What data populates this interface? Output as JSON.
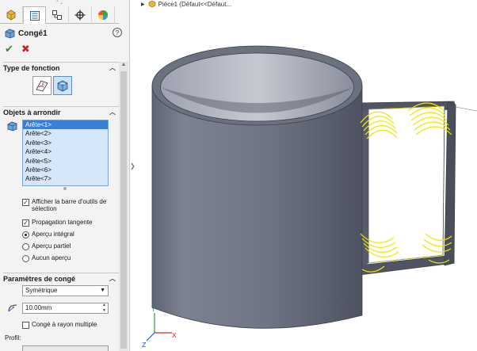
{
  "window": {
    "tree_title": "Pièce1  (Défaut<<Défaut..."
  },
  "tabs": [
    {
      "icon": "feature-manager-icon"
    },
    {
      "icon": "property-manager-icon"
    },
    {
      "icon": "configuration-manager-icon"
    },
    {
      "icon": "dimxpert-icon"
    },
    {
      "icon": "display-manager-icon"
    }
  ],
  "property_manager": {
    "title": "Congé1",
    "help": "?",
    "sections": {
      "fillet_type": "Type de fonction",
      "items_to_fillet": "Objets à arrondir",
      "fillet_params": "Paramètres de congé",
      "profile": "Profil:"
    },
    "edges": [
      "Arête<1>",
      "Arête<2>",
      "Arête<3>",
      "Arête<4>",
      "Arête<5>",
      "Arête<6>",
      "Arête<7>"
    ],
    "selected_edge_index": 0,
    "options": {
      "show_toolbar": "Afficher la barre d'outils de sélection",
      "tangent_propagation": "Propagation tangente",
      "full_preview": "Aperçu intégral",
      "partial_preview": "Aperçu partiel",
      "no_preview": "Aucun aperçu",
      "multi_radius": "Congé à rayon multiple"
    },
    "checked": {
      "show_toolbar": true,
      "tangent_propagation": true,
      "multi_radius": false
    },
    "preview_mode": "full_preview",
    "symmetric": "Symétrique",
    "radius": "10.00mm"
  },
  "colors": {
    "accent": "#3a7fd5",
    "list_bg": "#d5e7f8",
    "mug_body": "#6d7282",
    "preview_yellow": "#f2e600"
  }
}
